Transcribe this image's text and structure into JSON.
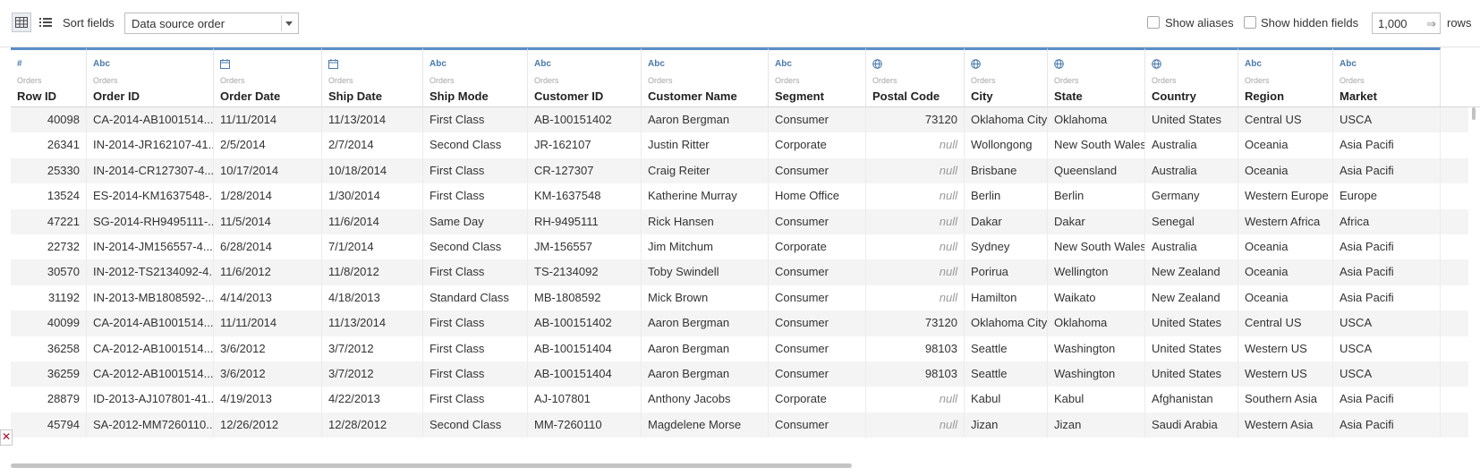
{
  "toolbar": {
    "sort_label": "Sort fields",
    "sort_value": "Data source order",
    "show_aliases_label": "Show aliases",
    "show_aliases_checked": false,
    "show_hidden_label": "Show hidden fields",
    "show_hidden_checked": false,
    "rows_value": "1,000",
    "rows_label": "rows",
    "rows_arrow": "⇒",
    "close_glyph": "✕"
  },
  "columns": [
    {
      "type": "#",
      "source": "Orders",
      "name": "Row ID",
      "align": "num"
    },
    {
      "type": "Abc",
      "source": "Orders",
      "name": "Order ID",
      "align": "text"
    },
    {
      "type": "date",
      "source": "Orders",
      "name": "Order Date",
      "align": "text"
    },
    {
      "type": "date",
      "source": "Orders",
      "name": "Ship Date",
      "align": "text"
    },
    {
      "type": "Abc",
      "source": "Orders",
      "name": "Ship Mode",
      "align": "text"
    },
    {
      "type": "Abc",
      "source": "Orders",
      "name": "Customer ID",
      "align": "text"
    },
    {
      "type": "Abc",
      "source": "Orders",
      "name": "Customer Name",
      "align": "text"
    },
    {
      "type": "Abc",
      "source": "Orders",
      "name": "Segment",
      "align": "text"
    },
    {
      "type": "geo",
      "source": "Orders",
      "name": "Postal Code",
      "align": "num"
    },
    {
      "type": "geo",
      "source": "Orders",
      "name": "City",
      "align": "text"
    },
    {
      "type": "geo",
      "source": "Orders",
      "name": "State",
      "align": "text"
    },
    {
      "type": "geo",
      "source": "Orders",
      "name": "Country",
      "align": "text"
    },
    {
      "type": "Abc",
      "source": "Orders",
      "name": "Region",
      "align": "text"
    },
    {
      "type": "Abc",
      "source": "Orders",
      "name": "Market",
      "align": "text"
    }
  ],
  "rows": [
    [
      "40098",
      "CA-2014-AB1001514...",
      "11/11/2014",
      "11/13/2014",
      "First Class",
      "AB-100151402",
      "Aaron Bergman",
      "Consumer",
      "73120",
      "Oklahoma City",
      "Oklahoma",
      "United States",
      "Central US",
      "USCA"
    ],
    [
      "26341",
      "IN-2014-JR162107-41...",
      "2/5/2014",
      "2/7/2014",
      "Second Class",
      "JR-162107",
      "Justin Ritter",
      "Corporate",
      "null",
      "Wollongong",
      "New South Wales",
      "Australia",
      "Oceania",
      "Asia Pacifi"
    ],
    [
      "25330",
      "IN-2014-CR127307-4...",
      "10/17/2014",
      "10/18/2014",
      "First Class",
      "CR-127307",
      "Craig Reiter",
      "Consumer",
      "null",
      "Brisbane",
      "Queensland",
      "Australia",
      "Oceania",
      "Asia Pacifi"
    ],
    [
      "13524",
      "ES-2014-KM1637548-...",
      "1/28/2014",
      "1/30/2014",
      "First Class",
      "KM-1637548",
      "Katherine Murray",
      "Home Office",
      "null",
      "Berlin",
      "Berlin",
      "Germany",
      "Western Europe",
      "Europe"
    ],
    [
      "47221",
      "SG-2014-RH9495111-...",
      "11/5/2014",
      "11/6/2014",
      "Same Day",
      "RH-9495111",
      "Rick Hansen",
      "Consumer",
      "null",
      "Dakar",
      "Dakar",
      "Senegal",
      "Western Africa",
      "Africa"
    ],
    [
      "22732",
      "IN-2014-JM156557-4...",
      "6/28/2014",
      "7/1/2014",
      "Second Class",
      "JM-156557",
      "Jim Mitchum",
      "Corporate",
      "null",
      "Sydney",
      "New South Wales",
      "Australia",
      "Oceania",
      "Asia Pacifi"
    ],
    [
      "30570",
      "IN-2012-TS2134092-4...",
      "11/6/2012",
      "11/8/2012",
      "First Class",
      "TS-2134092",
      "Toby Swindell",
      "Consumer",
      "null",
      "Porirua",
      "Wellington",
      "New Zealand",
      "Oceania",
      "Asia Pacifi"
    ],
    [
      "31192",
      "IN-2013-MB1808592-...",
      "4/14/2013",
      "4/18/2013",
      "Standard Class",
      "MB-1808592",
      "Mick Brown",
      "Consumer",
      "null",
      "Hamilton",
      "Waikato",
      "New Zealand",
      "Oceania",
      "Asia Pacifi"
    ],
    [
      "40099",
      "CA-2014-AB1001514...",
      "11/11/2014",
      "11/13/2014",
      "First Class",
      "AB-100151402",
      "Aaron Bergman",
      "Consumer",
      "73120",
      "Oklahoma City",
      "Oklahoma",
      "United States",
      "Central US",
      "USCA"
    ],
    [
      "36258",
      "CA-2012-AB1001514...",
      "3/6/2012",
      "3/7/2012",
      "First Class",
      "AB-100151404",
      "Aaron Bergman",
      "Consumer",
      "98103",
      "Seattle",
      "Washington",
      "United States",
      "Western US",
      "USCA"
    ],
    [
      "36259",
      "CA-2012-AB1001514...",
      "3/6/2012",
      "3/7/2012",
      "First Class",
      "AB-100151404",
      "Aaron Bergman",
      "Consumer",
      "98103",
      "Seattle",
      "Washington",
      "United States",
      "Western US",
      "USCA"
    ],
    [
      "28879",
      "ID-2013-AJ107801-41...",
      "4/19/2013",
      "4/22/2013",
      "First Class",
      "AJ-107801",
      "Anthony Jacobs",
      "Corporate",
      "null",
      "Kabul",
      "Kabul",
      "Afghanistan",
      "Southern Asia",
      "Asia Pacifi"
    ],
    [
      "45794",
      "SA-2012-MM7260110...",
      "12/26/2012",
      "12/28/2012",
      "Second Class",
      "MM-7260110",
      "Magdelene Morse",
      "Consumer",
      "null",
      "Jizan",
      "Jizan",
      "Saudi Arabia",
      "Western Asia",
      "Asia Pacifi"
    ]
  ]
}
